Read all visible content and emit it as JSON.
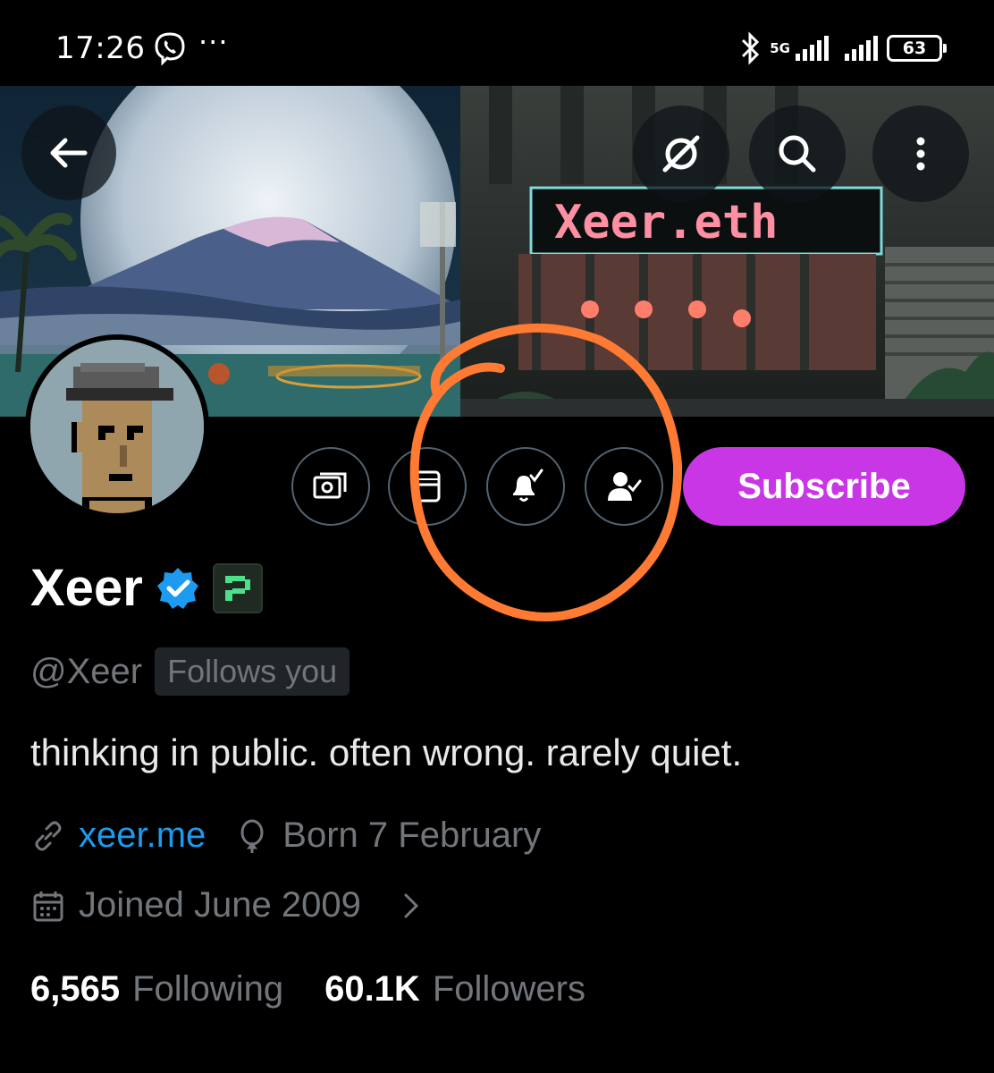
{
  "status_bar": {
    "time": "17:26",
    "dots": "···",
    "network_label": "5G",
    "battery": "63",
    "icons": [
      "viber-icon",
      "bluetooth-icon",
      "signal-icon",
      "battery-icon"
    ]
  },
  "banner": {
    "sign_text": "Xeer.eth",
    "buttons": [
      "back-arrow-icon",
      "grok-icon",
      "search-icon",
      "more-vertical-icon"
    ]
  },
  "profile": {
    "name": "Xeer",
    "handle": "@Xeer",
    "follows_you": "Follows you",
    "bio": "thinking in public. often wrong. rarely quiet.",
    "website": "xeer.me",
    "birthday": "Born 7 February",
    "joined": "Joined June 2009",
    "following_count": "6,565",
    "following_label": "Following",
    "followers_count": "60.1K",
    "followers_label": "Followers"
  },
  "actions": {
    "subscribe_label": "Subscribe",
    "icons": [
      "tip-money-icon",
      "newsletter-icon",
      "notifications-on-icon",
      "following-user-icon"
    ]
  },
  "colors": {
    "accent": "#1d9bf0",
    "subscribe_bg": "#c936e6",
    "muted": "#71767b",
    "annotation": "#ff7a33"
  }
}
